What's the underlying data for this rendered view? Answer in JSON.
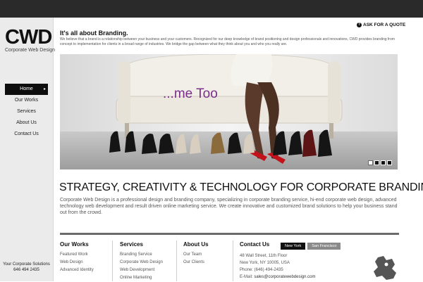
{
  "brand": {
    "logo": "CWD",
    "name": "Corporate Web Design"
  },
  "nav": {
    "items": [
      {
        "label": "Home"
      },
      {
        "label": "Our Works"
      },
      {
        "label": "Services"
      },
      {
        "label": "About Us"
      },
      {
        "label": "Contact Us"
      }
    ]
  },
  "sidebar_footer": {
    "line1": "Your Corporate Solutions",
    "phone": "646 494 2435"
  },
  "header": {
    "title": "It's all about Branding.",
    "intro": "We believe that a brand is a relationship between your business and your customers. Recognized for our deep knowledge of brand positioning and design professionals and innovations, CWD provides branding from concept to implementation for clients in a broad range of industries. We bridge the gap between what they think about you and who you really are.",
    "quote_button": "ASK FOR A QUOTE"
  },
  "hero": {
    "caption": "...me Too",
    "slides": 4,
    "active_slide": 1
  },
  "main": {
    "tagline": "STRATEGY, CREATIVITY & TECHNOLOGY FOR CORPORATE BRANDING",
    "description": "Corporate Web Design is a professional design and branding company, specializing in corporate branding service, hi-end corporate web design, advanced technology web development and result driven online marketing service. We create innovative and customized brand solutions to help your business stand out from the crowd."
  },
  "footer": {
    "our_works": {
      "title": "Our Works",
      "links": [
        "Featured Work",
        "Web Design",
        "Advanced Identity"
      ]
    },
    "services": {
      "title": "Services",
      "links": [
        "Branding Service",
        "Corporate Web Design",
        "Web Development",
        "Online Marketing"
      ]
    },
    "about": {
      "title": "About Us",
      "links": [
        "Our Team",
        "Our Clients"
      ]
    },
    "contact": {
      "title": "Contact Us",
      "tabs": [
        "New York",
        "San Francisco"
      ],
      "address1": "48 Wall Street, 11th Floor",
      "address2": "New York, NY 10005, USA",
      "phone": "Phone: (646) 494-2435",
      "email_label": "E-Mail:",
      "email": "sales@corporatewebdesign.com"
    }
  }
}
